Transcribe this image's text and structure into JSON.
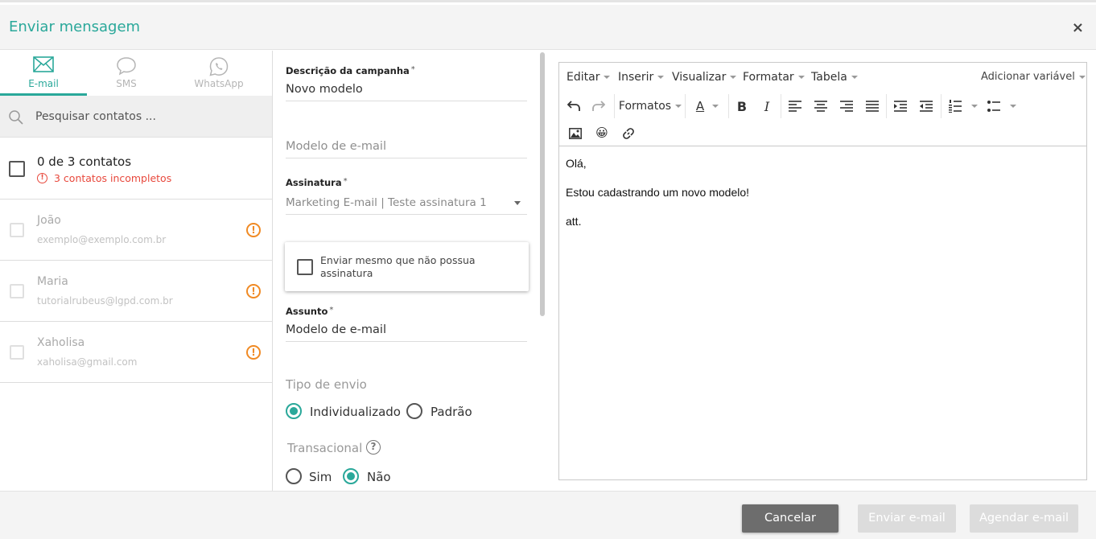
{
  "header": {
    "title": "Enviar mensagem",
    "close": "×"
  },
  "tabs": [
    {
      "label": "E-mail",
      "icon": "envelope-icon",
      "active": true
    },
    {
      "label": "SMS",
      "icon": "speech-bubble-icon",
      "active": false
    },
    {
      "label": "WhatsApp",
      "icon": "whatsapp-icon",
      "active": false
    }
  ],
  "search": {
    "placeholder": "Pesquisar contatos ..."
  },
  "summary": {
    "count": "0 de 3 contatos",
    "warning": "3 contatos incompletos"
  },
  "contacts": [
    {
      "name": "João",
      "email": "exemplo@exemplo.com.br"
    },
    {
      "name": "Maria",
      "email": "tutorialrubeus@lgpd.com.br"
    },
    {
      "name": "Xaholisa",
      "email": "xaholisa@gmail.com"
    }
  ],
  "form": {
    "descricao_label": "Descrição da campanha",
    "descricao_value": "Novo modelo",
    "modelo_placeholder": "Modelo de e-mail",
    "assinatura_label": "Assinatura",
    "assinatura_value": "Marketing E-mail | Teste assinatura 1",
    "enviar_sem_assinatura": "Enviar mesmo que não possua assinatura",
    "assunto_label": "Assunto",
    "assunto_value": "Modelo de e-mail",
    "tipo_envio_title": "Tipo de envio",
    "tipo_envio_options": [
      "Individualizado",
      "Padrão"
    ],
    "tipo_envio_selected": "Individualizado",
    "transacional_title": "Transacional",
    "transacional_options": [
      "Sim",
      "Não"
    ],
    "transacional_selected": "Não",
    "required_mark": "*"
  },
  "editor": {
    "menu": [
      "Editar",
      "Inserir",
      "Visualizar",
      "Formatar",
      "Tabela"
    ],
    "add_variable": "Adicionar variável",
    "formats_label": "Formatos",
    "text_color_label": "A",
    "bold_label": "B",
    "italic_label": "I",
    "emoji": "😀",
    "content": [
      "Olá,",
      "Estou cadastrando um novo modelo!",
      "att."
    ]
  },
  "footer": {
    "cancel": "Cancelar",
    "send": "Enviar e-mail",
    "schedule": "Agendar e-mail"
  },
  "colors": {
    "accent": "#2aa89a",
    "warning": "#e8483c",
    "alert": "#f08a24",
    "cancel_bg": "#6d6d6d",
    "disabled_bg": "#dcdcdc"
  }
}
